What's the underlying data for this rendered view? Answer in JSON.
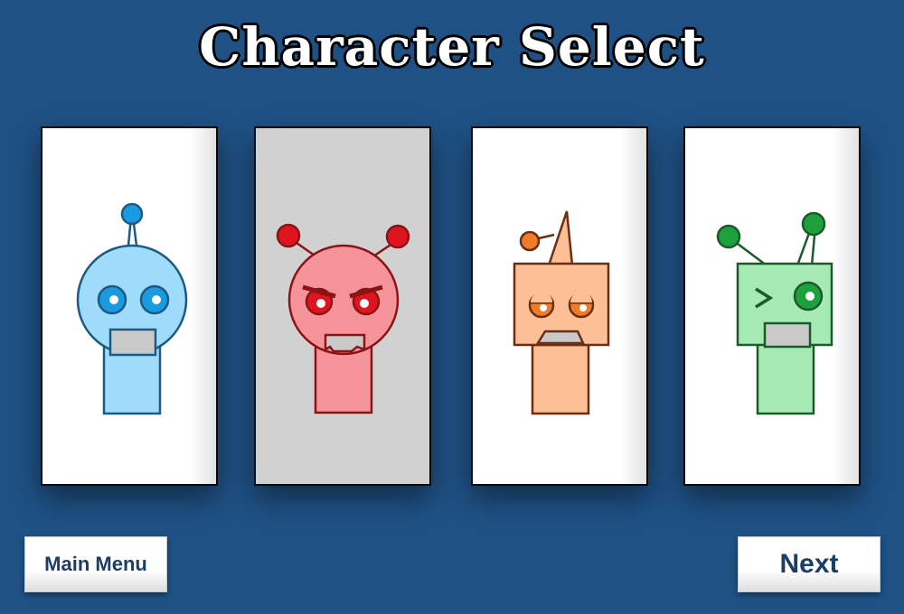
{
  "title": "Character Select",
  "selected_index": 1,
  "characters": [
    {
      "name": "blue-round-robot",
      "colors": {
        "fill": "#9fdcfb",
        "stroke": "#1c5a84",
        "eye": "#1a9ae0"
      }
    },
    {
      "name": "red-angry-robot",
      "colors": {
        "fill": "#f4949a",
        "stroke": "#8a1414",
        "eye": "#e0141e"
      }
    },
    {
      "name": "orange-party-robot",
      "colors": {
        "fill": "#fdbf95",
        "stroke": "#6b2e12",
        "eye": "#f07b28"
      }
    },
    {
      "name": "green-wink-robot",
      "colors": {
        "fill": "#a6eab6",
        "stroke": "#1c5a2a",
        "eye": "#1ea03c"
      }
    }
  ],
  "buttons": {
    "main_menu_label": "Main Menu",
    "next_label": "Next"
  },
  "colors": {
    "background": "#1f5185",
    "button_text": "#1c3d66",
    "selected_card": "#d1d1d1"
  }
}
